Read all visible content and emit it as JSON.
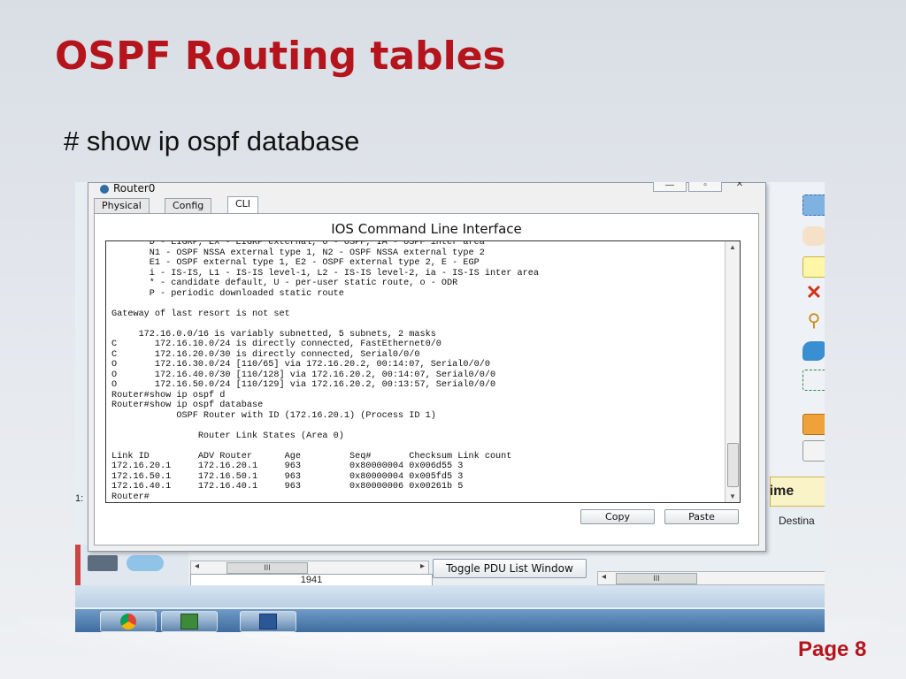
{
  "slide": {
    "title": "OSPF Routing tables",
    "bullet": "# show ip ospf database",
    "page": "Page 8"
  },
  "window": {
    "title": "Router0",
    "tabs": [
      "Physical",
      "Config",
      "CLI"
    ],
    "active_tab": "CLI",
    "cli_heading": "IOS Command Line Interface",
    "console_text": "       D - EIGRP, EX - EIGRP external, O - OSPF, IA - OSPF inter area\n       N1 - OSPF NSSA external type 1, N2 - OSPF NSSA external type 2\n       E1 - OSPF external type 1, E2 - OSPF external type 2, E - EGP\n       i - IS-IS, L1 - IS-IS level-1, L2 - IS-IS level-2, ia - IS-IS inter area\n       * - candidate default, U - per-user static route, o - ODR\n       P - periodic downloaded static route\n\nGateway of last resort is not set\n\n     172.16.0.0/16 is variably subnetted, 5 subnets, 2 masks\nC       172.16.10.0/24 is directly connected, FastEthernet0/0\nC       172.16.20.0/30 is directly connected, Serial0/0/0\nO       172.16.30.0/24 [110/65] via 172.16.20.2, 00:14:07, Serial0/0/0\nO       172.16.40.0/30 [110/128] via 172.16.20.2, 00:14:07, Serial0/0/0\nO       172.16.50.0/24 [110/129] via 172.16.20.2, 00:13:57, Serial0/0/0\nRouter#show ip ospf d\nRouter#show ip ospf database\n            OSPF Router with ID (172.16.20.1) (Process ID 1)\n\n                Router Link States (Area 0)\n\nLink ID         ADV Router      Age         Seq#       Checksum Link count\n172.16.20.1     172.16.20.1     963         0x80000004 0x006d55 3\n172.16.50.1     172.16.50.1     963         0x80000004 0x005fd5 3\n172.16.40.1     172.16.40.1     963         0x80000006 0x00261b 5\nRouter#",
    "copy_label": "Copy",
    "paste_label": "Paste"
  },
  "background_app": {
    "toggle_pdu_label": "Toggle PDU List Window",
    "model_label": "1941",
    "realtime_label": "altime",
    "destination_label": "Destina",
    "scroll_thumb_label": "III",
    "side_label": "1:"
  },
  "colors": {
    "title_red": "#b5141c",
    "taskbar_blue": "#4d7aab"
  }
}
